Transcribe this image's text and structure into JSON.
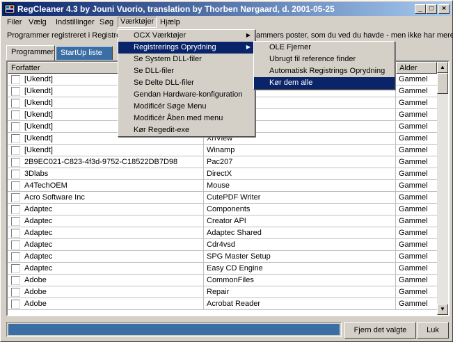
{
  "window": {
    "title": "RegCleaner 4.3 by Jouni Vuorio, translation by Thorben Nørgaard, d. 2001-05-25",
    "min_glyph": "_",
    "max_glyph": "□",
    "close_glyph": "×"
  },
  "menubar": {
    "items": [
      {
        "label": "Filer"
      },
      {
        "label": "Vælg"
      },
      {
        "label": "Indstillinger"
      },
      {
        "label": "Søg"
      },
      {
        "label": "Værktøjer"
      },
      {
        "label": "Hjælp"
      }
    ]
  },
  "info": {
    "text_left": "Programmer registreret i Registrei",
    "text_right": "ammers poster, som du ved du havde - men ikke har mere."
  },
  "tabs": [
    {
      "label": "Programmer"
    },
    {
      "label": "StartUp liste"
    }
  ],
  "list": {
    "columns": [
      "Forfatter",
      "",
      "Alder"
    ],
    "rows": [
      {
        "author": "[Ukendt]",
        "program": "",
        "age": "Gammel"
      },
      {
        "author": "[Ukendt]",
        "program": "",
        "age": "Gammel"
      },
      {
        "author": "[Ukendt]",
        "program": "ring",
        "age": "Gammel"
      },
      {
        "author": "[Ukendt]",
        "program": "",
        "age": "Gammel"
      },
      {
        "author": "[Ukendt]",
        "program": "",
        "age": "Gammel"
      },
      {
        "author": "[Ukendt]",
        "program": "XnView",
        "age": "Gammel"
      },
      {
        "author": "[Ukendt]",
        "program": "Winamp",
        "age": "Gammel"
      },
      {
        "author": "2B9EC021-C823-4f3d-9752-C18522DB7D98",
        "program": "Pac207",
        "age": "Gammel"
      },
      {
        "author": "3Dlabs",
        "program": "DirectX",
        "age": "Gammel"
      },
      {
        "author": "A4TechOEM",
        "program": "Mouse",
        "age": "Gammel"
      },
      {
        "author": "Acro Software Inc",
        "program": "CutePDF Writer",
        "age": "Gammel"
      },
      {
        "author": "Adaptec",
        "program": "Components",
        "age": "Gammel"
      },
      {
        "author": "Adaptec",
        "program": "Creator API",
        "age": "Gammel"
      },
      {
        "author": "Adaptec",
        "program": "Adaptec Shared",
        "age": "Gammel"
      },
      {
        "author": "Adaptec",
        "program": "Cdr4vsd",
        "age": "Gammel"
      },
      {
        "author": "Adaptec",
        "program": "SPG Master Setup",
        "age": "Gammel"
      },
      {
        "author": "Adaptec",
        "program": "Easy CD Engine",
        "age": "Gammel"
      },
      {
        "author": "Adobe",
        "program": "CommonFiles",
        "age": "Gammel"
      },
      {
        "author": "Adobe",
        "program": "Repair",
        "age": "Gammel"
      },
      {
        "author": "Adobe",
        "program": "Acrobat Reader",
        "age": "Gammel"
      }
    ]
  },
  "menu_tools": {
    "items": [
      {
        "label": "OCX Værktøjer",
        "submenu": true
      },
      {
        "label": "Registrerings Oprydning",
        "submenu": true
      },
      {
        "label": "Se System DLL-filer"
      },
      {
        "label": "Se DLL-filer"
      },
      {
        "label": "Se Delte DLL-filer"
      },
      {
        "label": "Gendan Hardware-konfiguration"
      },
      {
        "label": "Modificér Søge Menu"
      },
      {
        "label": "Modificér Åben med menu"
      },
      {
        "label": "Kør Regedit-exe"
      }
    ]
  },
  "submenu_cleanup": {
    "items": [
      {
        "label": "OLE Fjerner"
      },
      {
        "label": "Ubrugt fil reference finder"
      },
      {
        "label": "Automatisk Registrings Oprydning"
      },
      {
        "label": "Kør dem alle"
      }
    ]
  },
  "buttons": {
    "remove_label": "Fjern det valgte",
    "exit_label": "Luk"
  },
  "colors": {
    "title_start": "#0a246a",
    "title_end": "#a6caf0",
    "highlight": "#0a246a",
    "status_fill": "#3a6ea5"
  }
}
